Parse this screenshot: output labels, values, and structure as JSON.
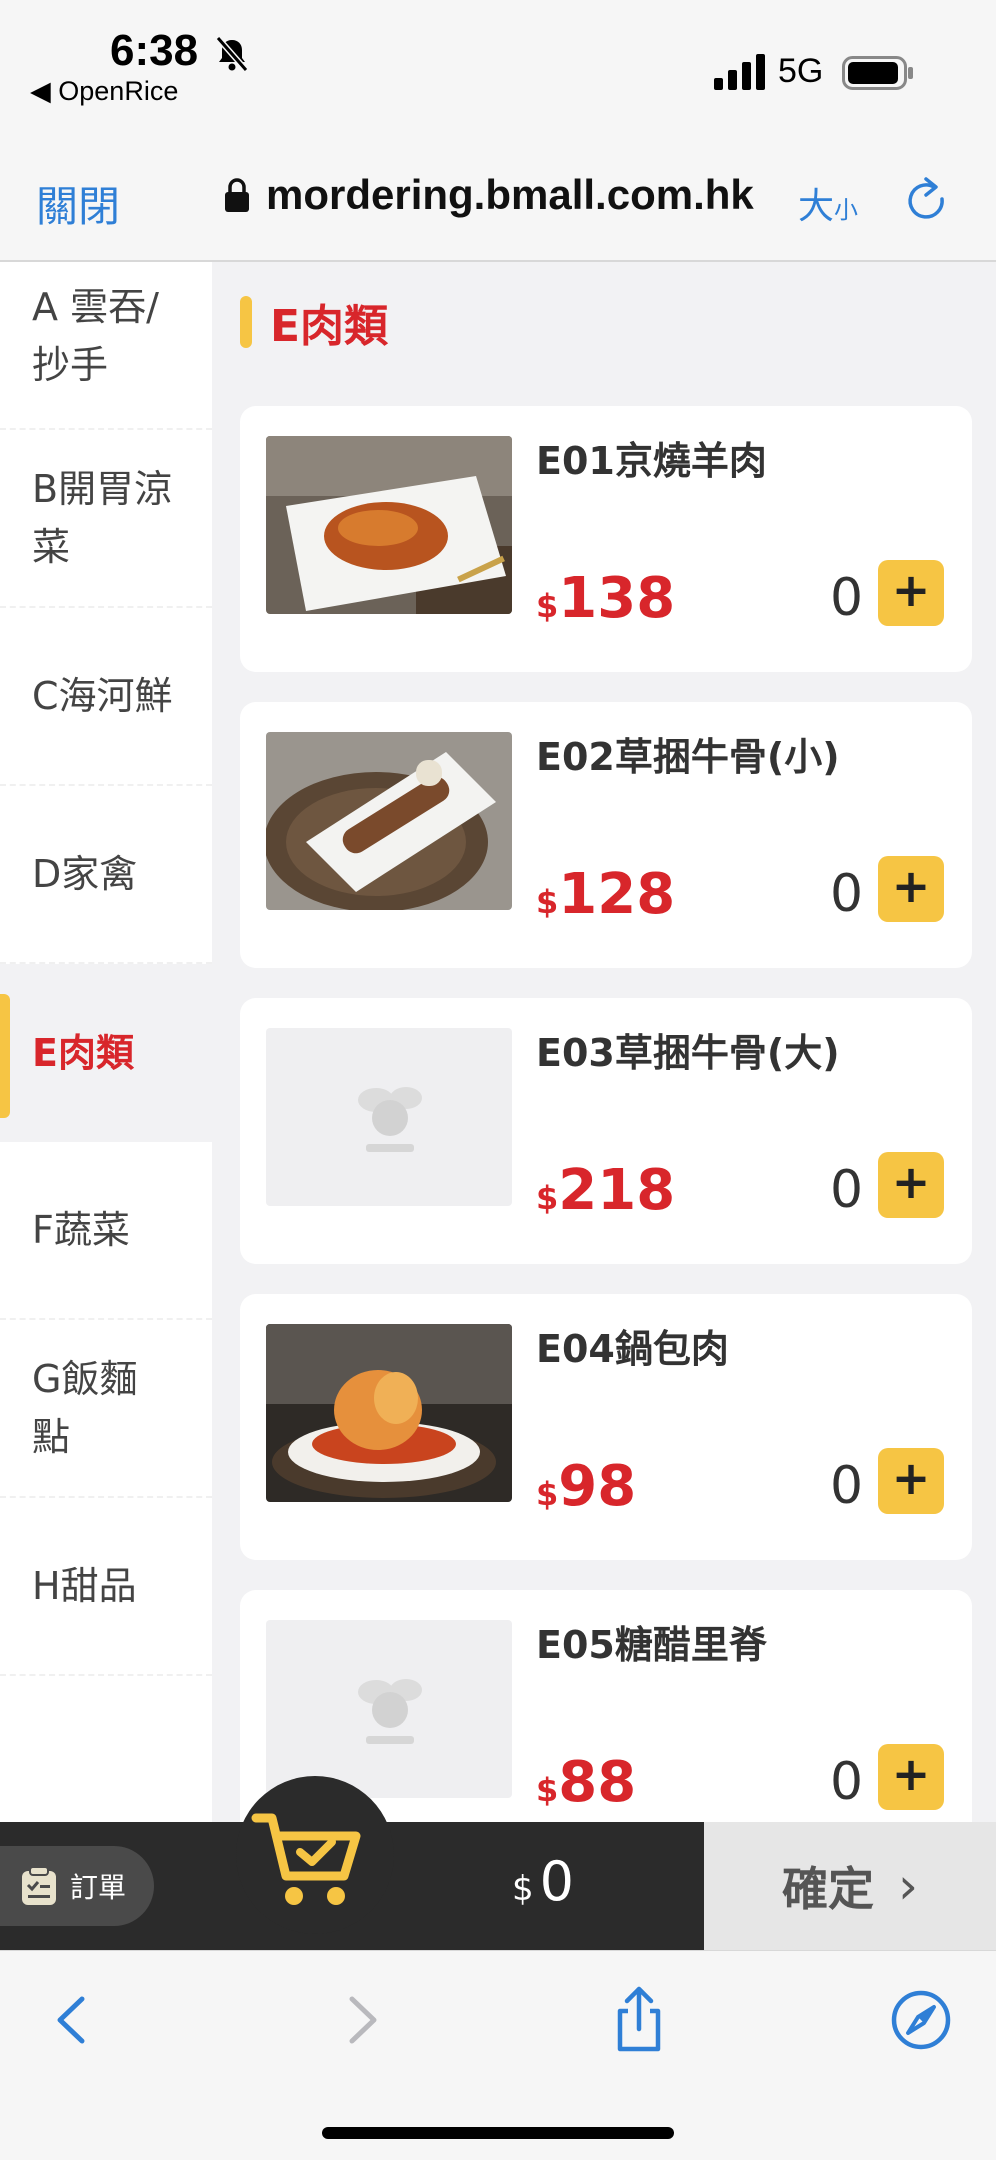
{
  "status_bar": {
    "time": "6:38",
    "back_app": "◀ OpenRice",
    "network": "5G"
  },
  "browser": {
    "close_label": "關閉",
    "url": "mordering.bmall.com.hk",
    "text_size_big": "大",
    "text_size_small": "小"
  },
  "sidebar": {
    "items": [
      {
        "label": "A 雲吞/抄手"
      },
      {
        "label": "B開胃涼菜"
      },
      {
        "label": "C海河鮮"
      },
      {
        "label": "D家禽"
      },
      {
        "label": "E肉類"
      },
      {
        "label": "F蔬菜"
      },
      {
        "label": "G飯麵點"
      },
      {
        "label": "H甜品"
      }
    ],
    "active_index": 4
  },
  "section": {
    "title": "E肉類"
  },
  "menu_items": [
    {
      "name": "E01京燒羊肉",
      "currency": "$",
      "price": "138",
      "qty": "0",
      "image": "dish-photo"
    },
    {
      "name": "E02草捆牛骨(小)",
      "currency": "$",
      "price": "128",
      "qty": "0",
      "image": "dish-photo"
    },
    {
      "name": "E03草捆牛骨(大)",
      "currency": "$",
      "price": "218",
      "qty": "0",
      "image": "placeholder"
    },
    {
      "name": "E04鍋包肉",
      "currency": "$",
      "price": "98",
      "qty": "0",
      "image": "dish-photo"
    },
    {
      "name": "E05糖醋里脊",
      "currency": "$",
      "price": "88",
      "qty": "0",
      "image": "placeholder"
    }
  ],
  "add_label": "+",
  "cart_bar": {
    "order_label": "訂單",
    "currency": "$",
    "total": "0",
    "confirm_label": "確定",
    "confirm_chevron": "›"
  },
  "colors": {
    "accent": "#f6c544",
    "price": "#d8262b",
    "link": "#2f7fd6",
    "bar": "#2b2b2b"
  }
}
